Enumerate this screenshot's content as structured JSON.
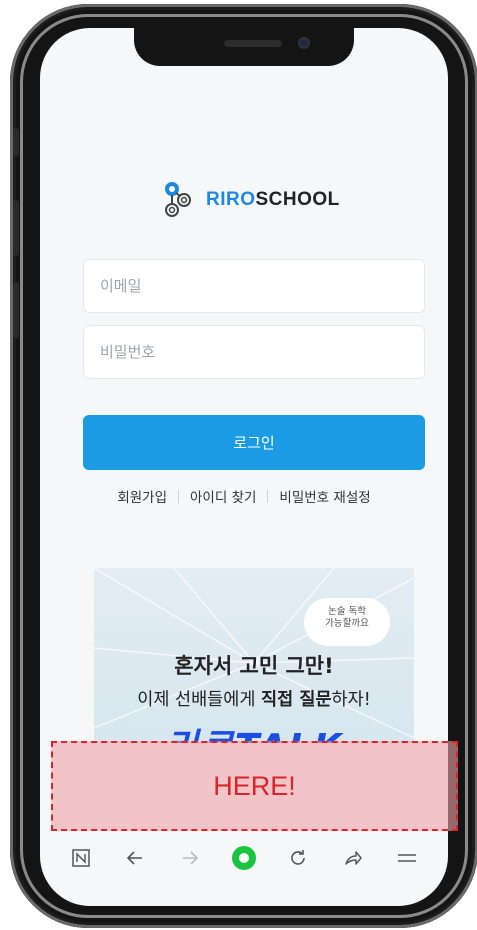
{
  "app": {
    "brand_prefix": "RIRO",
    "brand_suffix": "SCHOOL",
    "accent_color": "#1a9be4"
  },
  "login": {
    "email_placeholder": "이메일",
    "password_placeholder": "비밀번호",
    "login_button": "로그인"
  },
  "links": {
    "signup": "회원가입",
    "find_id": "아이디 찾기",
    "reset_password": "비밀번호 재설정"
  },
  "banner": {
    "bubble_line1": "논술 독학",
    "bubble_line2": "가능할까요",
    "headline": "혼자서 고민 그만!",
    "sub_prefix": "이제 선배들에게 ",
    "sub_emph": "직접 질문",
    "sub_suffix": "하자!",
    "logo_text": "리로TALK"
  },
  "overlay": {
    "label": "HERE!"
  },
  "toolbar": {
    "items": [
      "home-icon",
      "back-icon",
      "forward-icon",
      "tab-icon",
      "reload-icon",
      "share-icon",
      "menu-icon"
    ]
  }
}
